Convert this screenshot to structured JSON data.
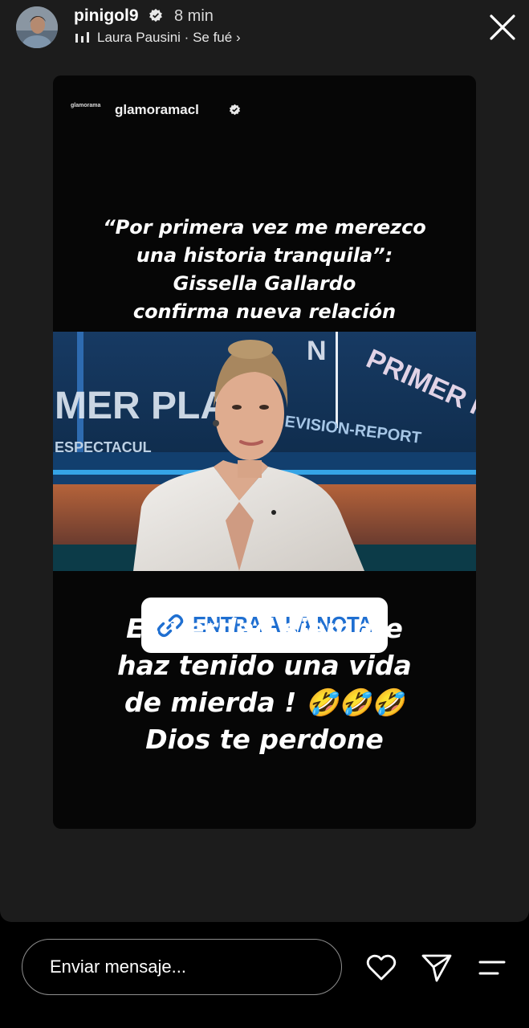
{
  "header": {
    "username": "pinigol9",
    "time": "8 min",
    "music": "Laura Pausini · Se fué ›",
    "icons": [
      "avatar",
      "verified-icon",
      "music-bars-icon",
      "close-icon"
    ]
  },
  "post": {
    "account": "glamoramacl",
    "mini_logo": "glamorama",
    "headline_lines": [
      "“Por primera vez me merezco",
      "una historia tranquila”:",
      "Gissella Gallardo",
      "confirma nueva relación"
    ],
    "photo_sign_left": "MER PLA",
    "photo_sign_sub": "ESPECTACUL",
    "photo_sign_right": "PRIMER PLANO",
    "photo_sign_band": "EVISION-REPORT",
    "photo_sign_letter": "N",
    "link_label": "ENTRA A LA NOTA"
  },
  "comment": {
    "lines": [
      "Es verdad siempre",
      "haz tenido una vida",
      "de mierda ! 🤣🤣🤣",
      "Dios te perdone"
    ]
  },
  "bottom": {
    "message_placeholder": "Enviar mensaje...",
    "icons": [
      "heart-icon",
      "send-icon",
      "menu-icon"
    ]
  },
  "colors": {
    "background": "#1c1c1c",
    "link_blue": "#1f6fd1",
    "card_bg": "#060606"
  }
}
